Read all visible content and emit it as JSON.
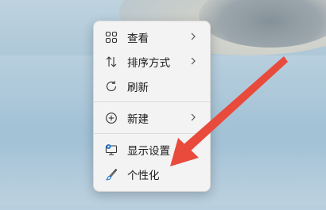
{
  "menu": {
    "items": [
      {
        "label": "查看",
        "icon": "grid-icon",
        "submenu": true
      },
      {
        "label": "排序方式",
        "icon": "sort-icon",
        "submenu": true
      },
      {
        "label": "刷新",
        "icon": "refresh-icon",
        "submenu": false
      },
      {
        "label": "新建",
        "icon": "new-icon",
        "submenu": true
      },
      {
        "label": "显示设置",
        "icon": "display-settings-icon",
        "submenu": false
      },
      {
        "label": "个性化",
        "icon": "brush-icon",
        "submenu": false
      }
    ]
  },
  "colors": {
    "accent_arrow": "#e84a3b",
    "menu_background": "#f3f3f3",
    "text": "#1a1a1a"
  }
}
